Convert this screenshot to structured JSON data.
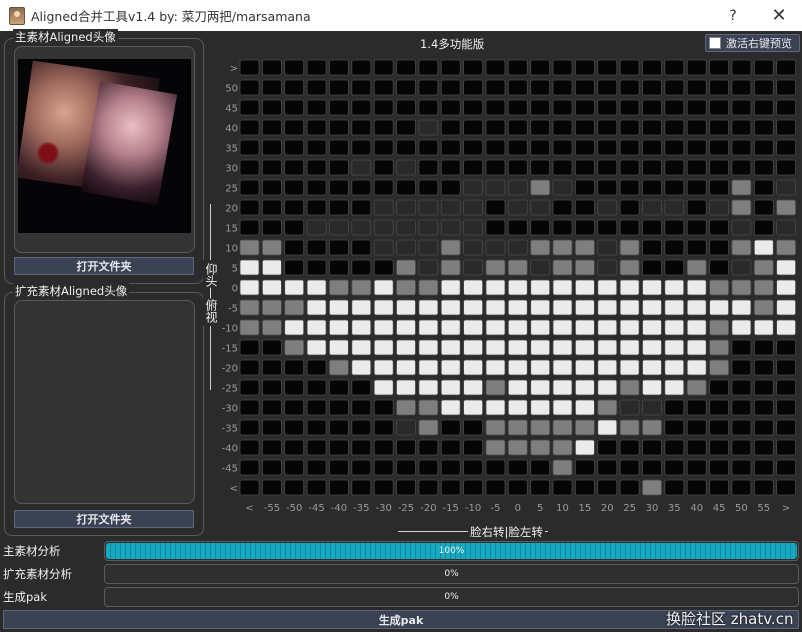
{
  "window": {
    "title": "Aligned合并工具v1.4  by: 菜刀两把/marsamana",
    "help": "?",
    "close": "✕"
  },
  "main_group": {
    "label": "主素材Aligned头像",
    "open_button": "打开文件夹"
  },
  "ext_group": {
    "label": "扩充素材Aligned头像",
    "open_button": "打开文件夹"
  },
  "grid_panel": {
    "title": "1.4多功能版",
    "preview_checkbox": "激活右键预览",
    "row_labels": [
      ">",
      "50",
      "45",
      "40",
      "35",
      "30",
      "25",
      "20",
      "15",
      "10",
      "5",
      "0",
      "-5",
      "-10",
      "-15",
      "-20",
      "-25",
      "-30",
      "-35",
      "-40",
      "-45",
      "<"
    ],
    "col_labels": [
      "<",
      "-55",
      "-50",
      "-45",
      "-40",
      "-35",
      "-30",
      "-25",
      "-20",
      "-15",
      "-10",
      "-5",
      "0",
      "5",
      "10",
      "15",
      "20",
      "25",
      "30",
      "35",
      "40",
      "45",
      "50",
      "55",
      ">"
    ],
    "vertical_axis": "仰头—俯视",
    "horizontal_axis": "脸右转|脸左转",
    "colors": {
      "0": "#050505",
      "1": "#2a2a2a",
      "2": "#7e7e7e",
      "3": "#ebebeb"
    },
    "cells": [
      "0000000000000000000000000",
      "0000000000000000000000000",
      "0000000000000000000000000",
      "0000000010000000000000000",
      "0000000000000000000000000",
      "0000010100000000000000000",
      "0000000000111210000000201",
      "0000001111101100101101202",
      "0001111111100000000000101",
      "2200001112111222120000232",
      "3300000212122122120020123",
      "3333223223333333333332223",
      "2223333333333333333333323",
      "2233333333333333333332333",
      "0023333333333333333332000",
      "0000233333333333333332000",
      "0000003333323333323320000",
      "0000000223333333211000000",
      "0000000120022222322000000",
      "0000000000022223000000000",
      "0000000000000020000000000",
      "0000000000000000002000000"
    ]
  },
  "progress": [
    {
      "label": "主素材分析",
      "value": 100,
      "text": "100%"
    },
    {
      "label": "扩充素材分析",
      "value": 0,
      "text": "0%"
    },
    {
      "label": "生成pak",
      "value": 0,
      "text": "0%"
    }
  ],
  "generate_button": "生成pak",
  "watermark": "换脸社区 zhatv.cn"
}
